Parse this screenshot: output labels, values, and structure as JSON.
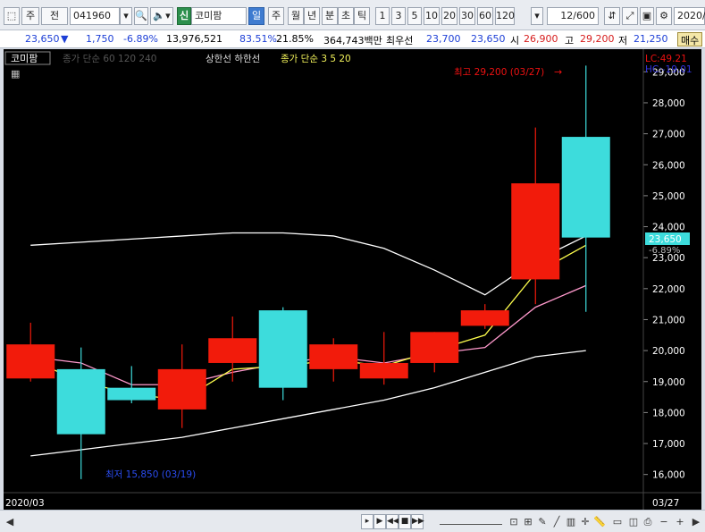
{
  "toolbar": {
    "market": "주",
    "prev_label": "전",
    "code": "041960",
    "new_badge": "신",
    "name": "코미팜",
    "periods": [
      "일",
      "주",
      "월",
      "년",
      "분",
      "초",
      "틱"
    ],
    "selected_period": "일",
    "intervals": [
      "1",
      "3",
      "5",
      "10",
      "20",
      "30",
      "60",
      "120"
    ],
    "count": "12/600",
    "date": "2020/0"
  },
  "quote": {
    "price": "23,650",
    "change": "1,750",
    "change_pct": "-6.89%",
    "volume": "13,976,521",
    "vol_ratio": "83.51%",
    "turnover": "21.85%",
    "amount": "364,743백만",
    "best_ask_label": "최우선",
    "best_ask": "23,700",
    "best_bid": "23,650",
    "open_label": "시",
    "open": "26,900",
    "high_label": "고",
    "high": "29,200",
    "low_label": "저",
    "low": "21,250",
    "order_button": "매수"
  },
  "chart": {
    "tag": "코미팜",
    "legend_ma_gray": "종가 단순 60 120 240",
    "legend_limit": "상한선 하한선",
    "legend_ma_yellow": "종가 단순 3 5 20",
    "lc": "LC:49.21",
    "hc": "HC:-19.01",
    "high_note": "최고 29,200 (03/27)",
    "low_note": "최저 15,850 (03/19)",
    "current_label": "23,650",
    "current_pct": "-6.89%",
    "x_start": "2020/03",
    "x_end": "03/27",
    "colors": {
      "up": "#f21b0b",
      "down": "#3ddcdc",
      "background": "#000000",
      "ma3": "#ffff4d",
      "ma5": "#ff99cc",
      "ma20": "#ffffff"
    }
  },
  "chart_data": {
    "type": "candlestick",
    "ylim": [
      15500,
      29500
    ],
    "yticks": [
      "16,000",
      "17,000",
      "18,000",
      "19,000",
      "20,000",
      "21,000",
      "22,000",
      "23,000",
      "24,000",
      "25,000",
      "26,000",
      "27,000",
      "28,000",
      "29,000"
    ],
    "candles": [
      {
        "o": 19100,
        "h": 20900,
        "l": 19000,
        "c": 20200
      },
      {
        "o": 19400,
        "h": 20100,
        "l": 15850,
        "c": 17300
      },
      {
        "o": 18800,
        "h": 19500,
        "l": 18300,
        "c": 18400
      },
      {
        "o": 18100,
        "h": 20200,
        "l": 17500,
        "c": 19400
      },
      {
        "o": 19600,
        "h": 21100,
        "l": 19000,
        "c": 20400
      },
      {
        "o": 21300,
        "h": 21400,
        "l": 18400,
        "c": 18800
      },
      {
        "o": 19400,
        "h": 20400,
        "l": 19000,
        "c": 20200
      },
      {
        "o": 19100,
        "h": 20600,
        "l": 18900,
        "c": 19600
      },
      {
        "o": 19600,
        "h": 20600,
        "l": 19300,
        "c": 20600
      },
      {
        "o": 20800,
        "h": 21500,
        "l": 20700,
        "c": 21300
      },
      {
        "o": 22300,
        "h": 27200,
        "l": 21500,
        "c": 25400
      },
      {
        "o": 26900,
        "h": 29200,
        "l": 21250,
        "c": 23650
      }
    ],
    "ma3": [
      19700,
      19000,
      18600,
      18400,
      19400,
      19500,
      19700,
      19500,
      20000,
      20500,
      22500,
      23400
    ],
    "ma5": [
      19800,
      19600,
      18900,
      18900,
      19300,
      19600,
      19800,
      19600,
      19900,
      20100,
      21400,
      22100
    ],
    "ma20": [
      16600,
      16800,
      17000,
      17200,
      17500,
      17800,
      18100,
      18400,
      18800,
      19300,
      19800,
      20000
    ],
    "upper": [
      23400,
      23500,
      23600,
      23700,
      23800,
      23800,
      23700,
      23300,
      22600,
      21800,
      22900,
      23700
    ]
  },
  "bottom": {
    "scroll_left": "◀",
    "scroll_right": "▶",
    "zoom_minus": "−",
    "zoom_plus": "+"
  }
}
